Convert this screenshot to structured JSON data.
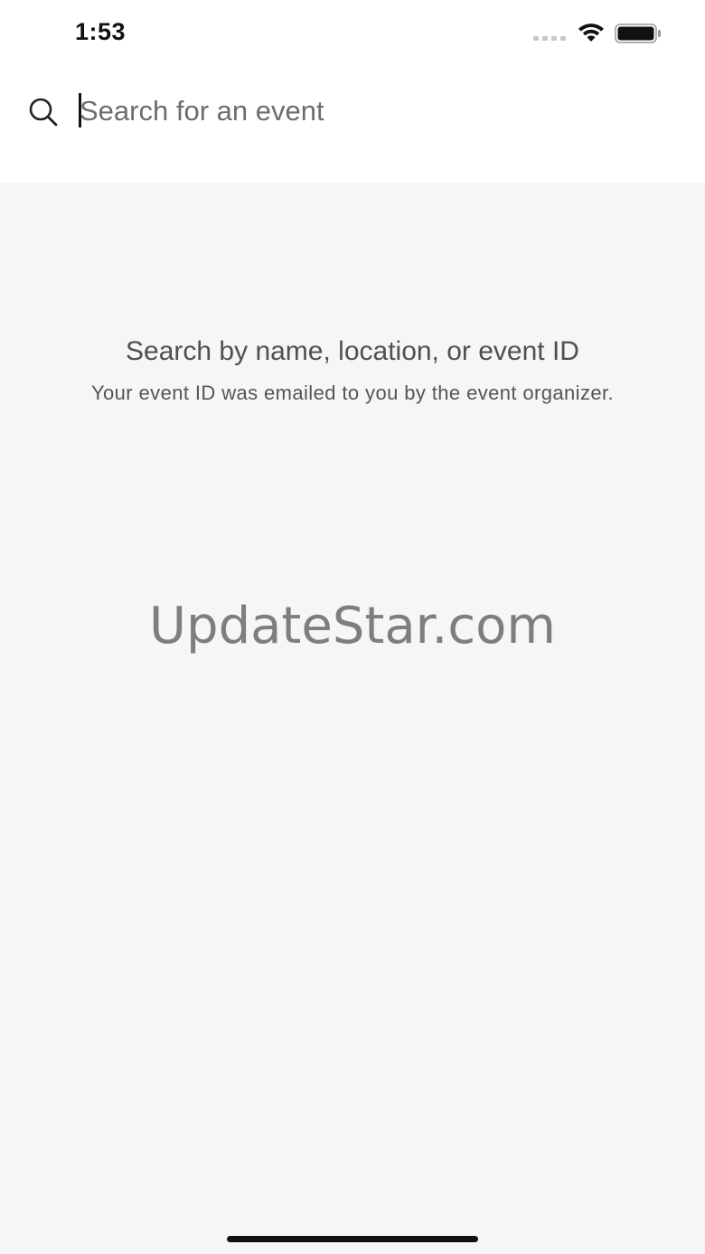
{
  "status_bar": {
    "time": "1:53"
  },
  "search": {
    "placeholder": "Search for an event",
    "value": ""
  },
  "empty_state": {
    "title": "Search by name, location, or event ID",
    "subtitle": "Your event ID was emailed to you by the event organizer."
  },
  "watermark": {
    "text": "UpdateStar.com"
  },
  "icons": {
    "search": "search-icon",
    "wifi": "wifi-icon",
    "battery": "battery-icon",
    "signal": "signal-icon"
  },
  "colors": {
    "background": "#f6f6f6",
    "header": "#ffffff",
    "text_primary": "#505050",
    "text_secondary": "#555555"
  }
}
